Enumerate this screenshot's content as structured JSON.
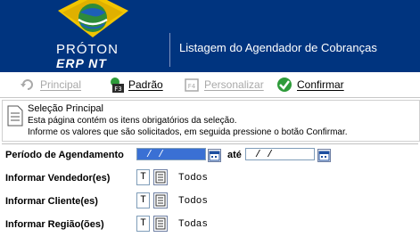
{
  "header": {
    "logo_word1": "PRÓTON",
    "logo_word2": "ERP NT",
    "title": "Listagem do Agendador de Cobranças"
  },
  "toolbar": {
    "principal": "Principal",
    "padrao": "Padrão",
    "padrao_key": "F3",
    "personalizar": "Personalizar",
    "personalizar_key": "F4",
    "confirmar": "Confirmar"
  },
  "info": {
    "title": "Seleção Principal",
    "line1": "Esta página contém os itens obrigatórios da seleção.",
    "line2": "Informe os valores que são solicitados, em seguida pressione o botão Confirmar."
  },
  "form": {
    "periodo_label": "Período de Agendamento",
    "date_from": " /  / ",
    "ate_label": "até",
    "date_to": " /  / ",
    "vendedor_label": "Informar Vendedor(es)",
    "vendedor_code": "T",
    "vendedor_value": "Todos",
    "cliente_label": "Informar Cliente(es)",
    "cliente_code": "T",
    "cliente_value": "Todos",
    "regiao_label": "Informar Região(ões)",
    "regiao_code": "T",
    "regiao_value": "Todas"
  },
  "colors": {
    "header_bg": "#00347f",
    "selection": "#3a70d4"
  }
}
